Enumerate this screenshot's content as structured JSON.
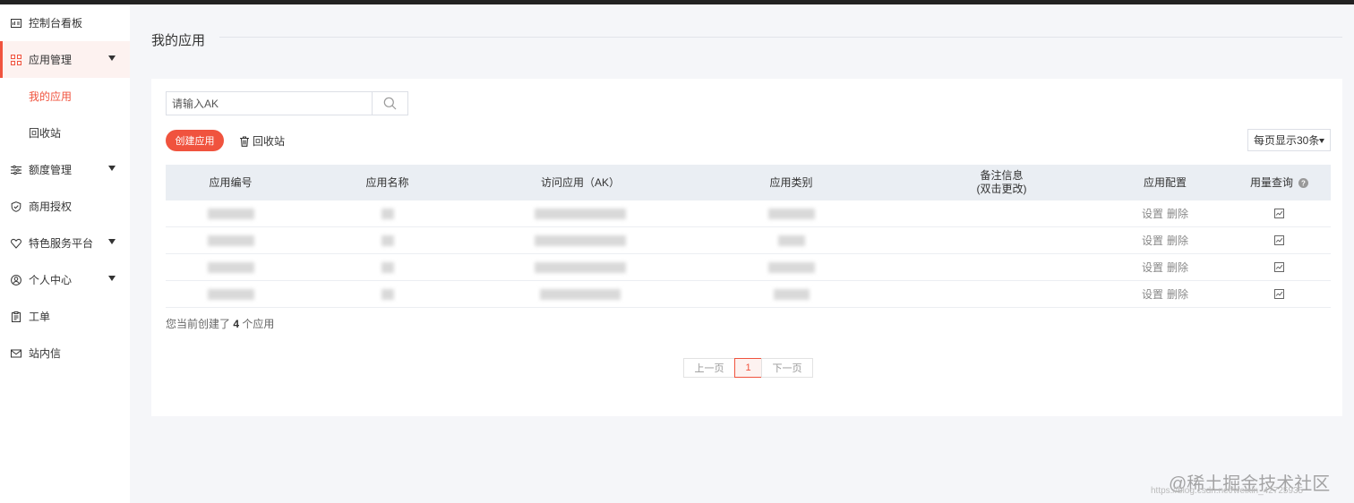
{
  "sidebar": {
    "items": [
      {
        "label": "控制台看板",
        "icon": "dashboard-icon"
      },
      {
        "label": "应用管理",
        "icon": "apps-grid-icon"
      },
      {
        "label": "额度管理",
        "icon": "sliders-icon"
      },
      {
        "label": "商用授权",
        "icon": "shield-check-icon"
      },
      {
        "label": "特色服务平台",
        "icon": "heart-shield-icon"
      },
      {
        "label": "个人中心",
        "icon": "user-circle-icon"
      },
      {
        "label": "工单",
        "icon": "clipboard-icon"
      },
      {
        "label": "站内信",
        "icon": "mail-icon"
      }
    ],
    "sub_items": [
      {
        "label": "我的应用"
      },
      {
        "label": "回收站"
      }
    ]
  },
  "page": {
    "title": "我的应用"
  },
  "search": {
    "placeholder": "请输入AK"
  },
  "toolbar": {
    "create_label": "创建应用",
    "recycle_label": "回收站",
    "page_size_label": "每页显示30条"
  },
  "table": {
    "headers": {
      "app_id": "应用编号",
      "app_name": "应用名称",
      "ak": "访问应用（AK）",
      "category": "应用类别",
      "remark_line1": "备注信息",
      "remark_line2": "(双击更改)",
      "config": "应用配置",
      "usage": "用量查询"
    },
    "row_actions": {
      "settings": "设置",
      "delete": "删除"
    }
  },
  "summary": {
    "prefix": "您当前创建了",
    "count": "4",
    "suffix": "个应用"
  },
  "pagination": {
    "prev": "上一页",
    "current": "1",
    "next": "下一页"
  },
  "watermark": {
    "text": "@稀土掘金技术社区",
    "url_text": "https://blog.csdn.net/weixin_42725935"
  },
  "colors": {
    "accent": "#f0533e",
    "header_bg": "#eaeef3",
    "page_bg": "#f5f6f9"
  }
}
